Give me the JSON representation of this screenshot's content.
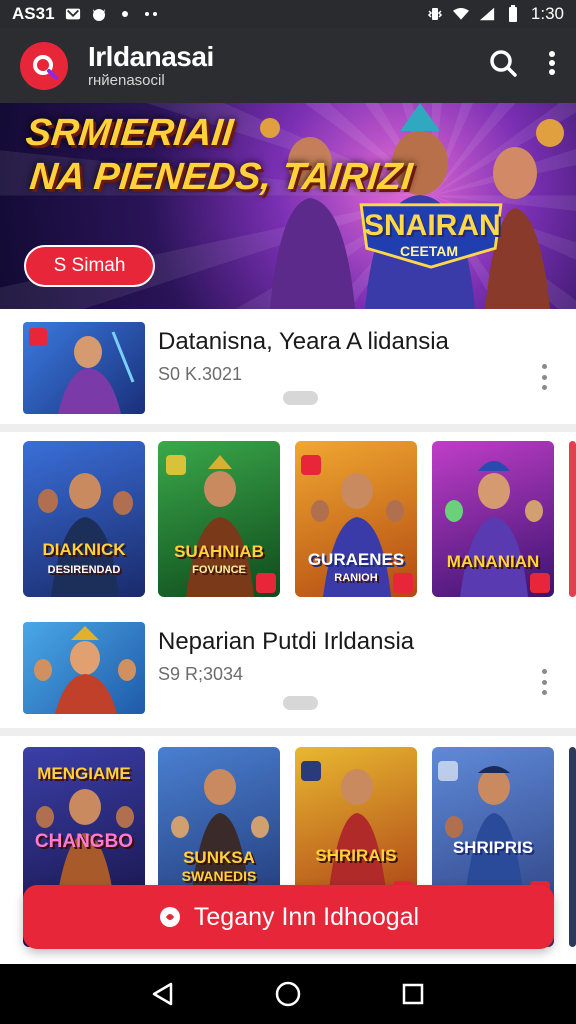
{
  "status_bar": {
    "carrier": "AS31",
    "time": "1:30"
  },
  "app_bar": {
    "title": "Irldanasai",
    "subtitle": "rнйеnasocil"
  },
  "banner": {
    "headline_line1": "SRMIERIAII",
    "headline_line2": "NA PIENEDS, TAIRIZI",
    "logo_title": "SNAIRAN",
    "logo_subtitle": "CEETAM",
    "cta_label": "S Simah"
  },
  "rows": [
    {
      "title": "Datanisna, Yeara A lidansia",
      "meta": "S0 K.3021"
    },
    {
      "title": "Neparian Putdi Irldansia",
      "meta": "S9 R;3034"
    }
  ],
  "grid1": [
    {
      "title": "DIAKNICK",
      "subtitle": "DESIRENDAD",
      "colors": [
        "#3a6fd8",
        "#1a2a6b"
      ]
    },
    {
      "title": "SUAHNIAB",
      "subtitle": "FOVUNCE",
      "colors": [
        "#3aa84a",
        "#0f4a1c"
      ]
    },
    {
      "title": "GURAENES",
      "subtitle": "RANIOH",
      "colors": [
        "#f0a830",
        "#b24a12"
      ]
    },
    {
      "title": "MANANIAN",
      "subtitle": "",
      "colors": [
        "#c03ec7",
        "#3a1370"
      ]
    }
  ],
  "grid2": [
    {
      "title": "MENGIAME",
      "subtitle": "CHANGBO",
      "colors": [
        "#3b3fa8",
        "#130f3d"
      ]
    },
    {
      "title": "SUNKSA",
      "subtitle": "SWANEDIS",
      "colors": [
        "#4a7fd0",
        "#1b2f6a"
      ]
    },
    {
      "title": "SHRIRAIS",
      "subtitle": "",
      "colors": [
        "#e8b830",
        "#a02a12"
      ]
    },
    {
      "title": "SHRIPRIS",
      "subtitle": "",
      "colors": [
        "#5f8ad8",
        "#2a3a7a"
      ]
    }
  ],
  "fab": {
    "label": "Tegany Inn Idhoogal"
  },
  "theme": {
    "accent": "#e8263a",
    "appbar": "#2c2d31"
  }
}
